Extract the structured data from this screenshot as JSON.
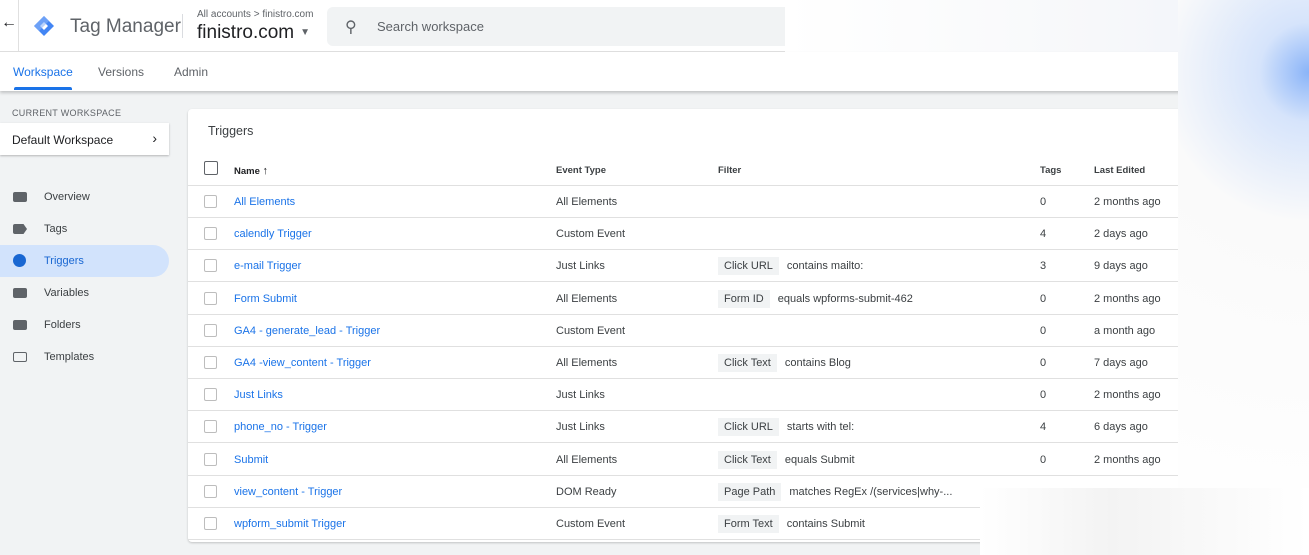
{
  "header": {
    "back_icon": "arrow-left",
    "product": "Tag Manager",
    "breadcrumb": "All accounts > finistro.com",
    "account": "finistro.com",
    "search_placeholder": "Search workspace"
  },
  "tabs": [
    {
      "label": "Workspace",
      "active": true
    },
    {
      "label": "Versions"
    },
    {
      "label": "Admin"
    }
  ],
  "workspace": {
    "label": "CURRENT WORKSPACE",
    "name": "Default Workspace"
  },
  "sidebar": [
    {
      "label": "Overview"
    },
    {
      "label": "Tags"
    },
    {
      "label": "Triggers",
      "active": true
    },
    {
      "label": "Variables"
    },
    {
      "label": "Folders"
    },
    {
      "label": "Templates"
    }
  ],
  "triggers": {
    "title": "Triggers",
    "columns": {
      "name": "Name",
      "sort": "↑",
      "event_type": "Event Type",
      "filter": "Filter",
      "tags": "Tags",
      "last_edited": "Last Edited"
    },
    "rows": [
      {
        "name": "All Elements",
        "event_type": "All Elements",
        "var": "",
        "cond": "",
        "tags": "0",
        "edited": "2 months ago"
      },
      {
        "name": "calendly Trigger",
        "event_type": "Custom Event",
        "var": "",
        "cond": "",
        "tags": "4",
        "edited": "2 days ago"
      },
      {
        "name": "e-mail Trigger",
        "event_type": "Just Links",
        "var": "Click URL",
        "cond": "contains mailto:",
        "tags": "3",
        "edited": "9 days ago"
      },
      {
        "name": "Form Submit",
        "event_type": "All Elements",
        "var": "Form ID",
        "cond": "equals wpforms-submit-462",
        "tags": "0",
        "edited": "2 months ago"
      },
      {
        "name": "GA4 - generate_lead - Trigger",
        "event_type": "Custom Event",
        "var": "",
        "cond": "",
        "tags": "0",
        "edited": "a month ago"
      },
      {
        "name": "GA4 -view_content - Trigger",
        "event_type": "All Elements",
        "var": "Click Text",
        "cond": "contains Blog",
        "tags": "0",
        "edited": "7 days ago"
      },
      {
        "name": "Just Links",
        "event_type": "Just Links",
        "var": "",
        "cond": "",
        "tags": "0",
        "edited": "2 months ago"
      },
      {
        "name": "phone_no - Trigger",
        "event_type": "Just Links",
        "var": "Click URL",
        "cond": "starts with tel:",
        "tags": "4",
        "edited": "6 days ago"
      },
      {
        "name": "Submit",
        "event_type": "All Elements",
        "var": "Click Text",
        "cond": "equals Submit",
        "tags": "0",
        "edited": "2 months ago"
      },
      {
        "name": "view_content - Trigger",
        "event_type": "DOM Ready",
        "var": "Page Path",
        "cond": "matches RegEx /(services|why-...",
        "tags": "",
        "edited": ""
      },
      {
        "name": "wpform_submit Trigger",
        "event_type": "Custom Event",
        "var": "Form Text",
        "cond": "contains Submit",
        "tags": "",
        "edited": ""
      }
    ]
  }
}
